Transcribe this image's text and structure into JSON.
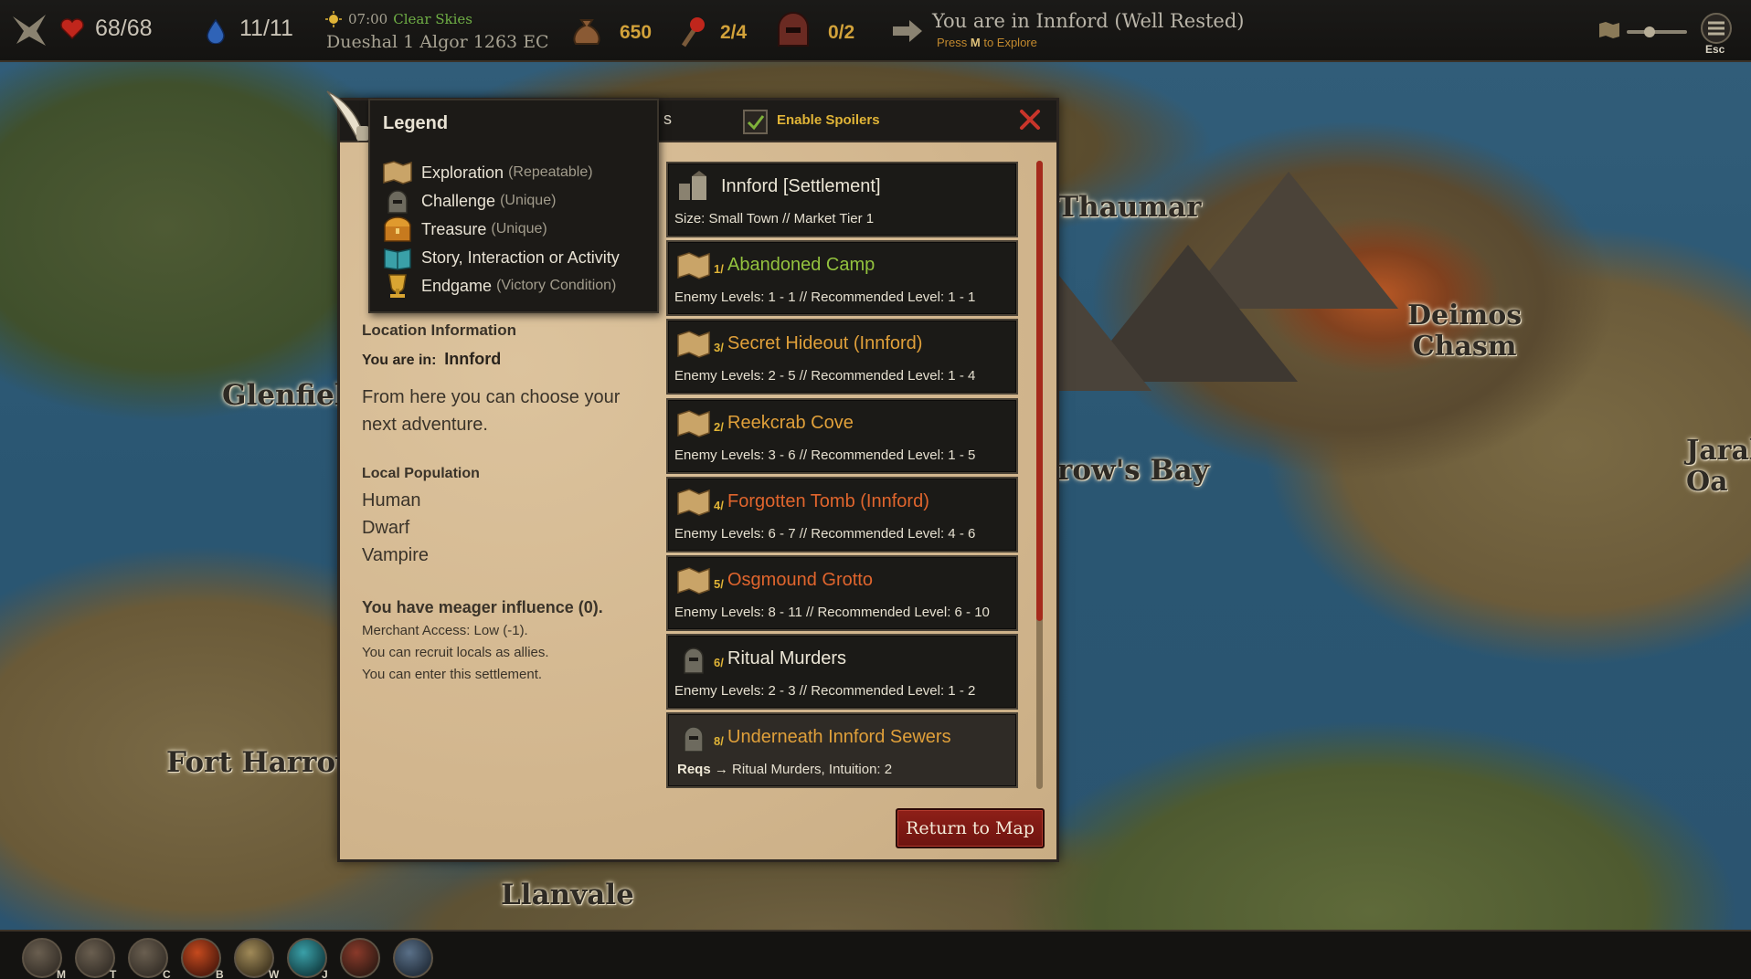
{
  "hud": {
    "health": "68/68",
    "mana": "11/11",
    "time": "07:00",
    "weather": "Clear Skies",
    "date": "Dueshal 1 Algor 1263 EC",
    "gold": "650",
    "supplies": "2/4",
    "party": "0/2",
    "location_text": "You are in Innford (Well Rested)",
    "hint_prefix": "Press",
    "hint_key": "M",
    "hint_suffix": "to Explore",
    "esc_label": "Esc"
  },
  "map_labels": {
    "thaumar": "Thaumar",
    "deimos": "Deimos\nChasm",
    "glenfield": "Glenfield",
    "bay": "row's Bay",
    "jaral": "Jaral\nOa",
    "fort_harrow": "Fort Harrow",
    "llanvale": "Llanvale"
  },
  "dialog": {
    "header_fragment": "s",
    "spoilers_label": "Enable Spoilers",
    "spoilers_checked": true,
    "return_button": "Return to Map"
  },
  "legend": {
    "title": "Legend",
    "items": [
      {
        "label": "Exploration",
        "sub": "(Repeatable)",
        "icon": "map-scroll-icon"
      },
      {
        "label": "Challenge",
        "sub": "(Unique)",
        "icon": "helmet-icon"
      },
      {
        "label": "Treasure",
        "sub": "(Unique)",
        "icon": "chest-icon"
      },
      {
        "label": "Story, Interaction or Activity",
        "sub": "",
        "icon": "book-icon"
      },
      {
        "label": "Endgame",
        "sub": "(Victory Condition)",
        "icon": "trophy-icon"
      }
    ]
  },
  "info": {
    "section_title": "Location Information",
    "you_are_in_label": "You are in:",
    "you_are_in_value": "Innford",
    "description": "From here you can choose your next adventure.",
    "population_title": "Local Population",
    "population": [
      "Human",
      "Dwarf",
      "Vampire"
    ],
    "influence": "You have meager influence (0).",
    "merchant": "Merchant Access: Low (-1).",
    "recruit": "You can recruit locals as allies.",
    "enter": "You can enter this settlement."
  },
  "adventures": [
    {
      "prefix": "",
      "title": "Innford [Settlement]",
      "detail": "Size: Small Town // Market Tier 1",
      "color": "white",
      "icon": "settlement-icon"
    },
    {
      "prefix": "1/",
      "title": "Abandoned Camp",
      "detail": "Enemy Levels: 1 - 1 // Recommended Level: 1 - 1",
      "color": "green",
      "icon": "map-scroll-icon"
    },
    {
      "prefix": "3/",
      "title": "Secret Hideout (Innford)",
      "detail": "Enemy Levels: 2 - 5 // Recommended Level: 1 - 4",
      "color": "orange",
      "icon": "map-scroll-icon"
    },
    {
      "prefix": "2/",
      "title": "Reekcrab Cove",
      "detail": "Enemy Levels: 3 - 6 // Recommended Level: 1 - 5",
      "color": "orange",
      "icon": "map-scroll-icon"
    },
    {
      "prefix": "4/",
      "title": "Forgotten Tomb (Innford)",
      "detail": "Enemy Levels: 6 - 7 // Recommended Level: 4 - 6",
      "color": "red",
      "icon": "map-scroll-icon"
    },
    {
      "prefix": "5/",
      "title": "Osgmound Grotto",
      "detail": "Enemy Levels: 8 - 11 // Recommended Level: 6 - 10",
      "color": "red",
      "icon": "map-scroll-icon"
    },
    {
      "prefix": "6/",
      "title": "Ritual Murders",
      "detail": "Enemy Levels: 2 - 3 // Recommended Level: 1 - 2",
      "color": "white",
      "icon": "helmet-icon"
    },
    {
      "prefix": "8/",
      "title": "Underneath Innford Sewers",
      "reqs_label": "Reqs",
      "detail": "Ritual Murders,  Intuition: 2",
      "color": "orange",
      "icon": "helmet-icon",
      "locked": true
    }
  ],
  "bottom_bar": [
    {
      "key": "M",
      "icon": "map-icon"
    },
    {
      "key": "T",
      "icon": "town-icon"
    },
    {
      "key": "C",
      "icon": "character-icon"
    },
    {
      "key": "B",
      "icon": "cards-icon"
    },
    {
      "key": "W",
      "icon": "scroll-icon"
    },
    {
      "key": "J",
      "icon": "journal-icon"
    },
    {
      "key": "",
      "icon": "quest-icon"
    },
    {
      "key": "",
      "icon": "settings-icon"
    }
  ],
  "colors": {
    "green": "#93c23e",
    "orange": "#e0a03a",
    "red": "#e0652d",
    "accent_gold": "#e0b437",
    "return_red": "#8e1f18"
  }
}
